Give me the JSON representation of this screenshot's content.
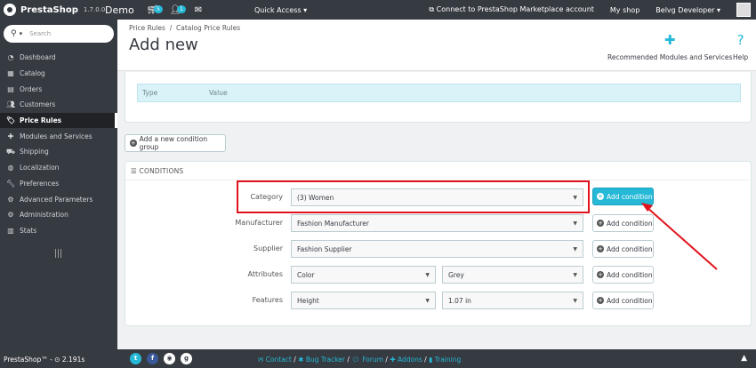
{
  "topbar": {
    "brand": "PrestaShop",
    "version": "1.7.0.0",
    "shop": "Demo",
    "cart_badge": "5",
    "customer_badge": "1",
    "quick_access": "Quick Access",
    "marketplace": "Connect to PrestaShop Marketplace account",
    "my_shop": "My shop",
    "user": "Belvg Developer"
  },
  "sidebar": {
    "search_placeholder": "Search",
    "items": [
      {
        "label": "Dashboard",
        "icon": "dashboard-icon"
      },
      {
        "label": "Catalog",
        "icon": "store-icon"
      },
      {
        "label": "Orders",
        "icon": "orders-icon"
      },
      {
        "label": "Customers",
        "icon": "customers-icon"
      },
      {
        "label": "Price Rules",
        "icon": "tag-icon",
        "active": true
      },
      {
        "label": "Modules and Services",
        "icon": "puzzle-icon"
      },
      {
        "label": "Shipping",
        "icon": "truck-icon"
      },
      {
        "label": "Localization",
        "icon": "globe-icon"
      },
      {
        "label": "Preferences",
        "icon": "wrench-icon"
      },
      {
        "label": "Advanced Parameters",
        "icon": "cogs-icon"
      },
      {
        "label": "Administration",
        "icon": "gear-icon"
      },
      {
        "label": "Stats",
        "icon": "bar-chart-icon"
      }
    ]
  },
  "header": {
    "breadcrumb_1": "Price Rules",
    "breadcrumb_sep": "/",
    "breadcrumb_2": "Catalog Price Rules",
    "title": "Add new",
    "recommended": "Recommended Modules and Services",
    "help": "Help"
  },
  "group_table": {
    "col_type": "Type",
    "col_value": "Value"
  },
  "add_group_label": "Add a new condition group",
  "conditions": {
    "heading": "CONDITIONS",
    "add_label": "Add condition",
    "rows": [
      {
        "label": "Category",
        "value": "(3) Women",
        "highlighted": true
      },
      {
        "label": "Manufacturer",
        "value": "Fashion Manufacturer"
      },
      {
        "label": "Supplier",
        "value": "Fashion Supplier"
      },
      {
        "label": "Attributes",
        "value": "Color",
        "value2": "Grey"
      },
      {
        "label": "Features",
        "value": "Height",
        "value2": "1.07 in"
      }
    ]
  },
  "footer": {
    "left": "PrestaShop™ - ⊙ 2.191s",
    "contact": "Contact",
    "bug": "Bug Tracker",
    "forum": "Forum",
    "addons": "Addons",
    "training": "Training"
  },
  "colors": {
    "accent": "#25b9d7",
    "dark": "#363a41",
    "highlight": "#e0141e"
  }
}
